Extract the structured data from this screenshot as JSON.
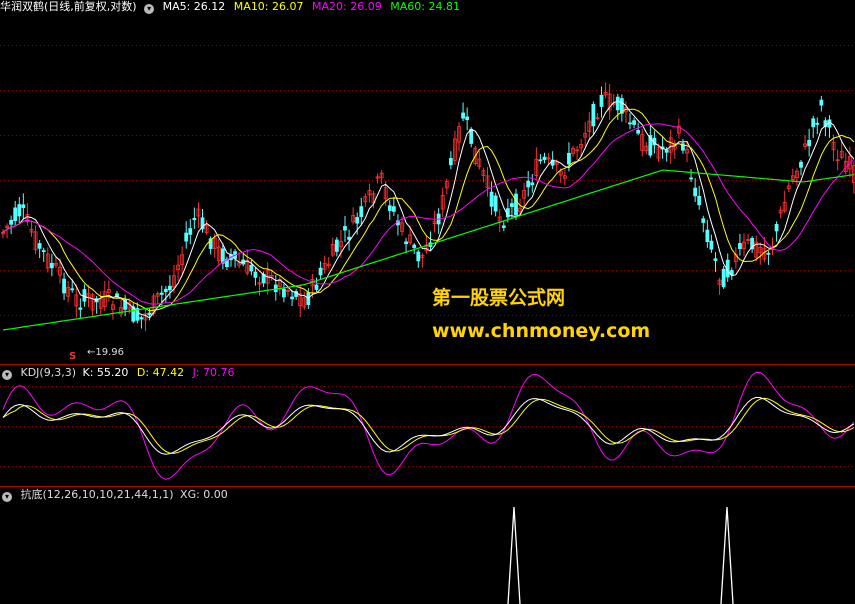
{
  "main_panel": {
    "title": "华润双鹤(日线,前复权,对数)",
    "ma_labels": [
      {
        "text": "MA5: 26.12",
        "color": "#ffffff"
      },
      {
        "text": "MA10: 26.07",
        "color": "#ffff00"
      },
      {
        "text": "MA20: 26.09",
        "color": "#ff00ff"
      },
      {
        "text": "MA60: 24.81",
        "color": "#00ff00"
      }
    ],
    "low_price_label": "19.96",
    "signal_mark": "S",
    "watermark_line1": "第一股票公式网",
    "watermark_line2": "www.chnmoney.com"
  },
  "kdj_panel": {
    "name": "KDJ(9,3,3)",
    "values": [
      {
        "text": "K: 55.20",
        "color": "#ffffff"
      },
      {
        "text": "D: 47.42",
        "color": "#ffff00"
      },
      {
        "text": "J: 70.76",
        "color": "#ff00ff"
      }
    ]
  },
  "bottom_panel": {
    "name": "抗底(12,26,10,10,21,44,1,1)",
    "value": "XG: 0.00"
  },
  "colors": {
    "up": "#ff3232",
    "down": "#54ffff",
    "ma5": "#ffffff",
    "ma10": "#ffff00",
    "ma20": "#ff00ff",
    "ma60": "#00ff00",
    "grid": "#8b0000",
    "separator": "#b00000"
  }
}
